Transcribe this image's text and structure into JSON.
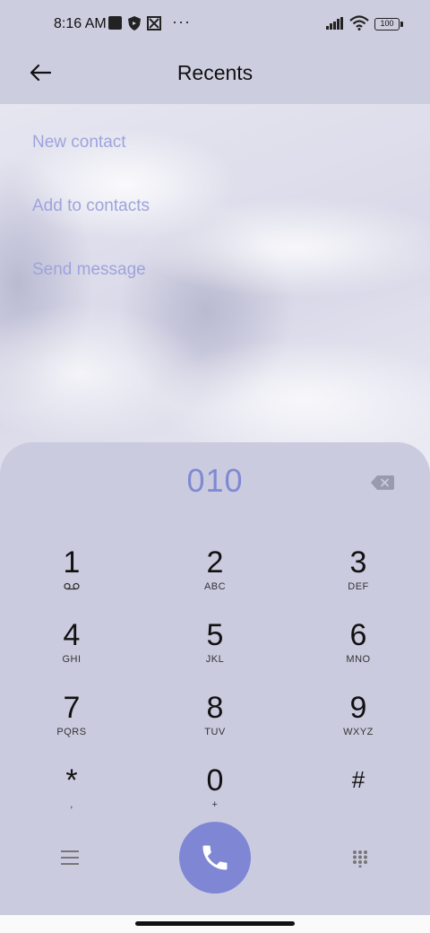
{
  "status_bar": {
    "time": "8:16 AM",
    "battery": "100",
    "icons": [
      "square-icon",
      "shield-icon",
      "network-icon",
      "more-icon",
      "signal-icon",
      "wifi-icon",
      "battery-icon"
    ]
  },
  "header": {
    "title": "Recents",
    "back_icon": "arrow-left-icon"
  },
  "menu": {
    "items": [
      {
        "label": "New contact"
      },
      {
        "label": "Add to contacts"
      },
      {
        "label": "Send message"
      }
    ]
  },
  "dialer": {
    "number": "010",
    "keys": [
      {
        "digit": "1",
        "letters": ""
      },
      {
        "digit": "2",
        "letters": "ABC"
      },
      {
        "digit": "3",
        "letters": "DEF"
      },
      {
        "digit": "4",
        "letters": "GHI"
      },
      {
        "digit": "5",
        "letters": "JKL"
      },
      {
        "digit": "6",
        "letters": "MNO"
      },
      {
        "digit": "7",
        "letters": "PQRS"
      },
      {
        "digit": "8",
        "letters": "TUV"
      },
      {
        "digit": "9",
        "letters": "WXYZ"
      },
      {
        "digit": "*",
        "letters": ","
      },
      {
        "digit": "0",
        "letters": "+"
      },
      {
        "digit": "#",
        "letters": ""
      }
    ]
  },
  "colors": {
    "accent": "#7f87d4",
    "menu_text": "#9ea3dc",
    "panel": "#cbcbe0"
  }
}
